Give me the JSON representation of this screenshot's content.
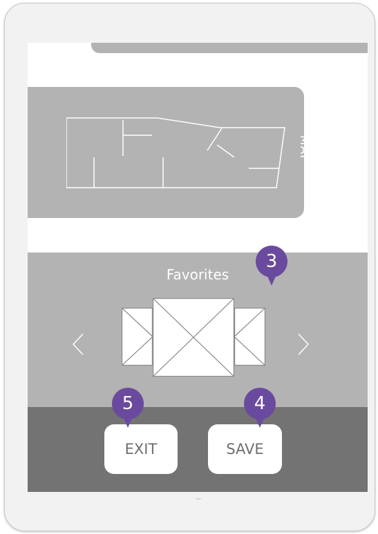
{
  "map": {
    "label": "MAP"
  },
  "favorites": {
    "title": "Favorites"
  },
  "buttons": {
    "exit_label": "EXIT",
    "save_label": "SAVE"
  },
  "badges": {
    "favorites": "3",
    "save": "4",
    "exit": "5"
  },
  "icons": {
    "prev": "chevron-left-icon",
    "next": "chevron-right-icon"
  },
  "colors": {
    "badge": "#6a4a9e",
    "panel": "#b3b3b3",
    "footer": "#737373"
  }
}
